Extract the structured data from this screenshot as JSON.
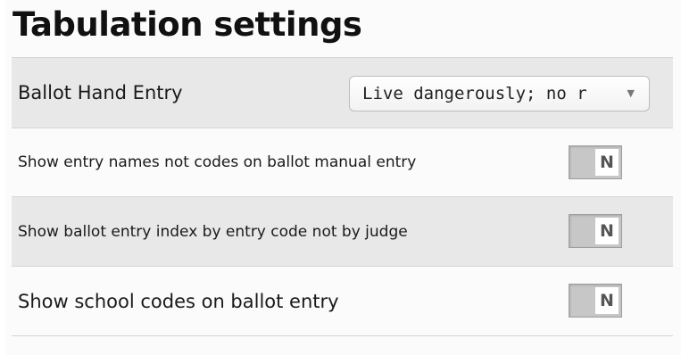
{
  "page": {
    "title": "Tabulation settings"
  },
  "settings": {
    "ballot_hand_entry": {
      "label": "Ballot Hand Entry",
      "selected": "Live dangerously; no r",
      "caret": "▼"
    },
    "entry_names": {
      "label": "Show entry names not codes on ballot manual entry",
      "value": "N"
    },
    "entry_index": {
      "label": "Show ballot entry index by entry code not by judge",
      "value": "N"
    },
    "school_codes": {
      "label": "Show school codes on ballot entry",
      "value": "N"
    }
  }
}
